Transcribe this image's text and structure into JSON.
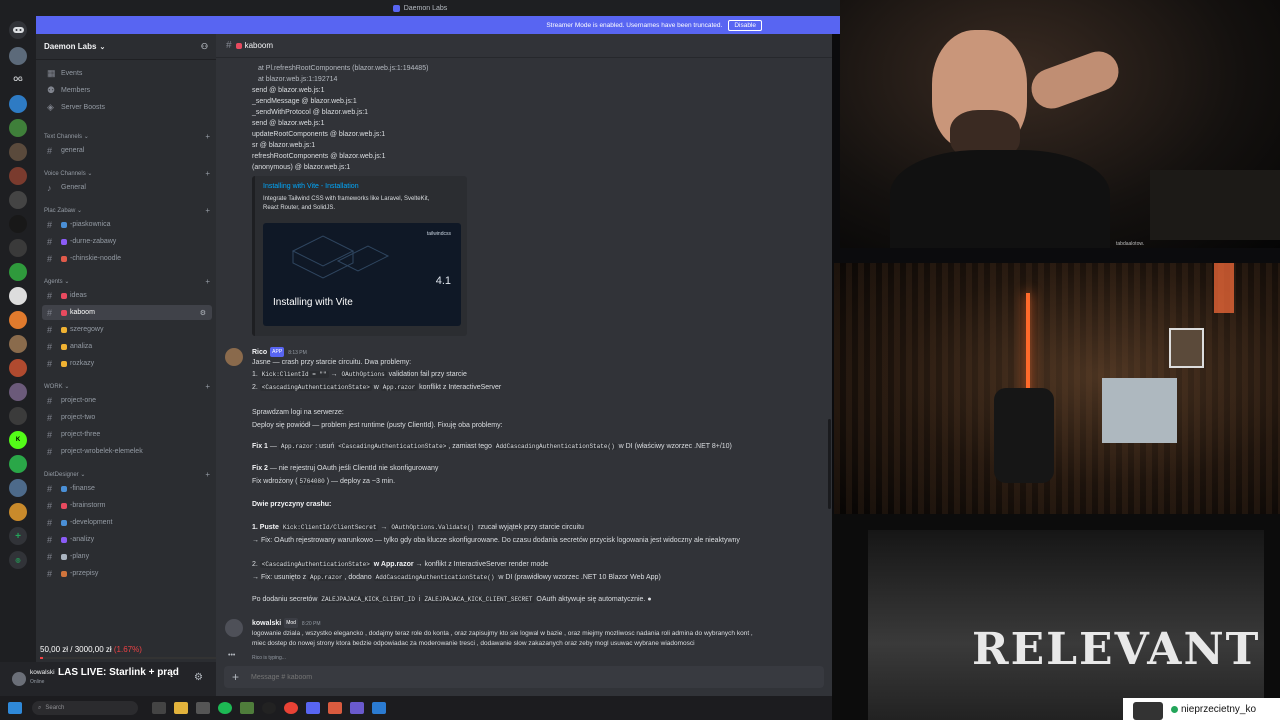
{
  "window_title": "Daemon Labs",
  "banner": {
    "text": "Streamer Mode is enabled. Usernames have been truncated.",
    "button": "Disable"
  },
  "rail": {
    "og_label": "OG"
  },
  "server": {
    "name": "Daemon Labs"
  },
  "sidebar": {
    "top_items": [
      "Events",
      "Members",
      "Server Boosts"
    ],
    "categories": {
      "text": "Text Channels",
      "voice": "Voice Channels",
      "plac": "Plac Zabaw",
      "agents": "Agents",
      "work": "WORK",
      "diet": "DietDesigner"
    },
    "text_channels": [
      "general"
    ],
    "voice_channels": [
      "General"
    ],
    "plac_channels": [
      "-piaskownica",
      "-durne-zabawy",
      "-chinskie-noodle"
    ],
    "agents_channels": [
      "ideas",
      "kaboom",
      "szeregowy",
      "analiza",
      "rozkazy"
    ],
    "work_channels": [
      "project-one",
      "project-two",
      "project-three",
      "project-wrobelek-elemelek"
    ],
    "diet_channels": [
      "-finanse",
      "-brainstorm",
      "-development",
      "-analizy",
      "-plany",
      "-przepisy"
    ]
  },
  "chat": {
    "channel": "kaboom",
    "stack": [
      "at Pl.refreshRootComponents (blazor.web.js:1:194485)",
      "at blazor.web.js:1:192714",
      "send @ blazor.web.js:1",
      "_sendMessage @ blazor.web.js:1",
      "_sendWithProtocol @ blazor.web.js:1",
      "send @ blazor.web.js:1",
      "updateRootComponents @ blazor.web.js:1",
      "sr @ blazor.web.js:1",
      "refreshRootComponents @ blazor.web.js:1",
      "(anonymous) @ blazor.web.js:1"
    ],
    "embed": {
      "title": "Installing with Vite - Installation",
      "desc1": "Integrate Tailwind CSS with frameworks like Laravel, SvelteKit,",
      "desc2": "React Router, and SolidJS.",
      "img_brand": "tailwindcss",
      "img_title": "Installing with Vite",
      "img_version": "4.1"
    },
    "rico": {
      "name": "Rico",
      "badge": "APP",
      "time": "8:13 PM",
      "l1": "Jasne — crash przy starcie circuitu. Dwa problemy:",
      "l2_code1": "Kick:ClientId = \"\"",
      "l2_code2": "OAuthOptions",
      "l2_text": "validation fail przy starcie",
      "l3_code1": "<CascadingAuthenticationState>",
      "l3_mid": "w",
      "l3_code2": "App.razor",
      "l3_text": "konflikt z InteractiveServer",
      "l4": "Sprawdzam logi na serwerze:",
      "l5": "Deploy się powiódł — problem jest runtime (pusty ClientId). Fixuję oba problemy:",
      "fix1_label": "Fix 1",
      "fix1_code1": "App.razor",
      "fix1_a": ": usuń",
      "fix1_code2": "<CascadingAuthenticationState>",
      "fix1_b": ", zamiast tego",
      "fix1_code3": "AddCascadingAuthenticationState()",
      "fix1_c": "w DI (właściwy wzorzec .NET 8+/10)",
      "fix2_label": "Fix 2",
      "fix2_text": "— nie rejestruj OAuth jeśli ClientId nie skonfigurowany",
      "deploy_a": "Fix wdrożony (",
      "deploy_code": "5764080",
      "deploy_b": ") — deploy za ~3 min.",
      "causes": "Dwie przyczyny crashu:",
      "c1_label": "1. Puste",
      "c1_code": "Kick:ClientId/ClientSecret",
      "c1_code2": "OAuthOptions.Validate()",
      "c1_text": "rzucał wyjątek przy starcie circuitu",
      "c1_fix": "→ Fix: OAuth rejestrowany warunkowo — tylko gdy oba klucze skonfigurowane. Do czasu dodania secretów przycisk logowania jest widoczny ale nieaktywny",
      "c2_code": "<CascadingAuthenticationState>",
      "c2_code2": "w App.razor",
      "c2_text": "→ konflikt z InteractiveServer render mode",
      "c2_fix_a": "→ Fix: usunięto z",
      "c2_fix_code1": "App.razor",
      "c2_fix_b": ", dodano",
      "c2_fix_code2": "AddCascadingAuthenticationState()",
      "c2_fix_c": "w DI (prawidłowy wzorzec .NET 10 Blazor Web App)",
      "end_a": "Po dodaniu secretów",
      "end_code1": "ZALEJPAJACA_KICK_CLIENT_ID",
      "end_mid": "i",
      "end_code2": "ZALEJPAJACA_KICK_CLIENT_SECRET",
      "end_b": "OAuth aktywuje się automatycznie."
    },
    "kowalski": {
      "name": "kowalski",
      "badge": "Mod",
      "time": "8:20 PM",
      "l1": "logowanie dziala , wszystko elegancko , dodajmy teraz role do konta , oraz zapisujmy kto sie logwal w bazie , oraz miejmy mozliwosc nadania roli admina do wybranych kont ,",
      "l2": "miec dostep do nowej strony ktora bedzie odpowiadac za moderowanie tresci , dodawanie slow zakazanych oraz zeby mogl usuwac wybrane wiadomosci"
    },
    "typing": "Rico is typing...",
    "placeholder": "Message # kaboom"
  },
  "userbar": {
    "name": "kowalski",
    "status": "Online"
  },
  "taskbar": {
    "search": "Search"
  },
  "overlay": {
    "donation_current": "50,00 zł",
    "donation_slash": "/",
    "donation_goal": "3000,00 zł",
    "donation_pct": "(1.67%)",
    "stream_title": "LAS LIVE: Starlink + prąd",
    "relevant": "RELEVANT",
    "cam_caption": "tabdaalotow.",
    "streamer_tag": "nieprzecietny_ko"
  },
  "colors": {
    "blurple": "#5865f2",
    "online": "#23a55a",
    "bg_chat": "#313338",
    "bg_sidebar": "#2b2d31"
  }
}
